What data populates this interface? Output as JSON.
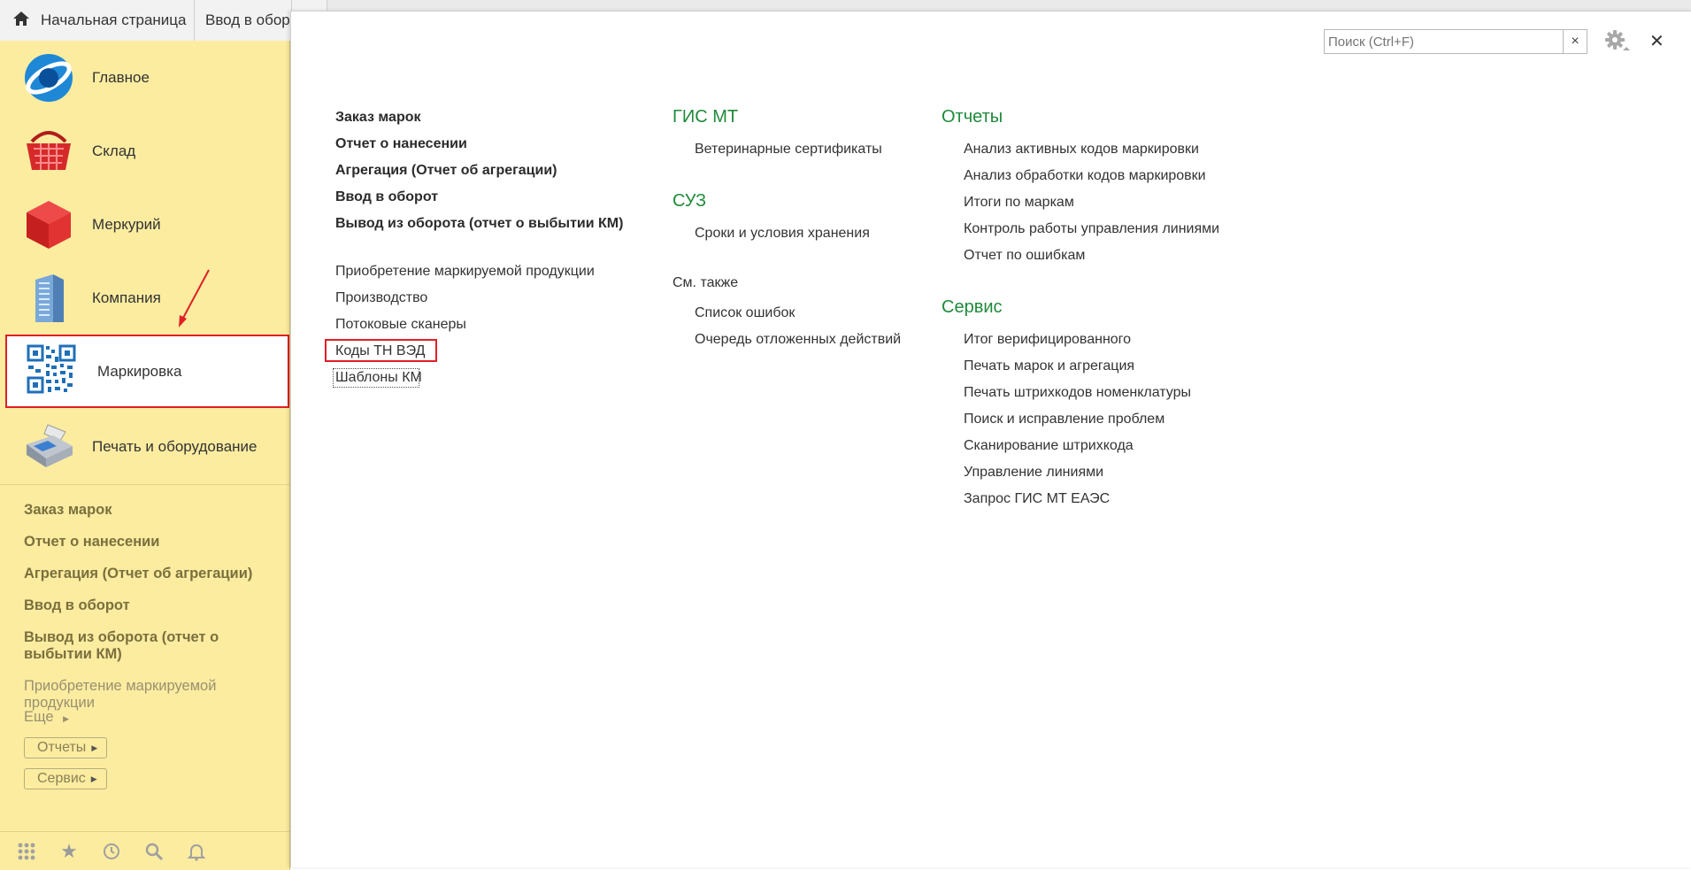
{
  "tabs": {
    "home": "Начальная страница",
    "second": "Ввод в оборо"
  },
  "sidebar": {
    "sections": [
      {
        "label": "Главное",
        "icon": "main-globe-icon"
      },
      {
        "label": "Склад",
        "icon": "warehouse-basket-icon"
      },
      {
        "label": "Меркурий",
        "icon": "mercury-cube-icon"
      },
      {
        "label": "Компания",
        "icon": "company-building-icon"
      },
      {
        "label": "Маркировка",
        "icon": "qr-code-icon"
      },
      {
        "label": "Печать и оборудование",
        "icon": "printer-terminal-icon"
      }
    ],
    "sub_items": [
      "Заказ марок",
      "Отчет о нанесении",
      "Агрегация (Отчет об агрегации)",
      "Ввод в оборот",
      "Вывод из оборота (отчет о выбытии КМ)",
      "Приобретение маркируемой продукции"
    ],
    "more_label": "Еще",
    "reports_label": "Отчеты",
    "service_label": "Сервис"
  },
  "search": {
    "placeholder": "Поиск (Ctrl+F)"
  },
  "main": {
    "col1_bold": [
      "Заказ марок",
      "Отчет о нанесении",
      "Агрегация (Отчет об агрегации)",
      "Ввод в оборот",
      "Вывод из оборота (отчет о выбытии КМ)"
    ],
    "col1_normal": [
      "Приобретение маркируемой продукции",
      "Производство",
      "Потоковые сканеры",
      "Коды ТН ВЭД",
      "Шаблоны КМ"
    ],
    "gis_mt": {
      "heading": "ГИС МТ",
      "items": [
        "Ветеринарные сертификаты"
      ]
    },
    "suz": {
      "heading": "СУЗ",
      "items": [
        "Сроки и условия хранения"
      ]
    },
    "see_also": {
      "heading": "См. также",
      "items": [
        "Список ошибок",
        "Очередь отложенных действий"
      ]
    },
    "reports": {
      "heading": "Отчеты",
      "items": [
        "Анализ активных кодов маркировки",
        "Анализ обработки кодов маркировки",
        "Итоги по маркам",
        "Контроль работы управления линиями",
        "Отчет по ошибкам"
      ]
    },
    "service": {
      "heading": "Сервис",
      "items": [
        "Итог верифицированного",
        "Печать марок и агрегация",
        "Печать штрихкодов номенклатуры",
        "Поиск и исправление проблем",
        "Сканирование штрихкода",
        "Управление линиями",
        "Запрос ГИС МТ ЕАЭС"
      ]
    }
  },
  "colors": {
    "sidebar_bg": "#fbeca0",
    "heading_green": "#1f8a3b",
    "highlight_red": "#e01f26"
  }
}
